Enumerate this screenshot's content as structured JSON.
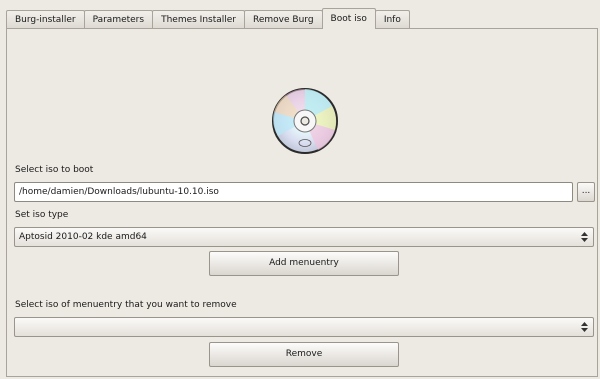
{
  "tabs": [
    {
      "label": "Burg-installer"
    },
    {
      "label": "Parameters"
    },
    {
      "label": "Themes Installer"
    },
    {
      "label": "Remove Burg"
    },
    {
      "label": "Boot iso"
    },
    {
      "label": "Info"
    }
  ],
  "active_tab": "Boot iso",
  "boot_iso": {
    "select_iso_label": "Select iso to boot",
    "iso_path_value": "/home/damien/Downloads/lubuntu-10.10.iso",
    "browse_label": "...",
    "iso_type_label": "Set iso type",
    "iso_type_selected": "Aptosid 2010-02 kde amd64",
    "add_button_label": "Add menuentry",
    "remove_select_label": "Select iso of menuentry that you want to remove",
    "remove_selected": "",
    "remove_button_label": "Remove"
  },
  "icons": {
    "disc": "cd-disc-icon",
    "combo_arrows": "updown-arrows-icon"
  }
}
